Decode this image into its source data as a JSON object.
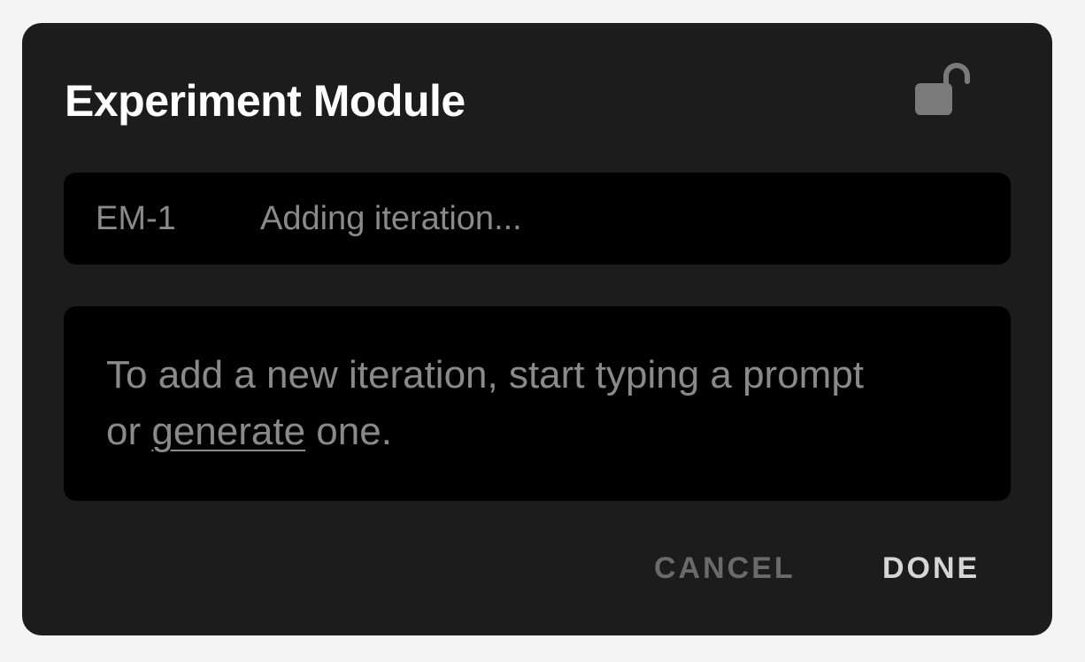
{
  "dialog": {
    "title": "Experiment Module",
    "lock_icon": "unlocked-padlock-icon"
  },
  "iteration": {
    "id": "EM-1",
    "status": "Adding iteration..."
  },
  "prompt": {
    "text_before": "To add a new iteration, start typing a prompt or ",
    "link_label": "generate",
    "text_after": " one."
  },
  "actions": {
    "cancel_label": "CANCEL",
    "done_label": "DONE"
  },
  "colors": {
    "dialog_background": "#1c1c1c",
    "field_background": "#000000",
    "page_background": "#f4f4f4",
    "muted_text": "#8a8a8a",
    "title_text": "#ffffff",
    "lock_icon": "#7a7a7a"
  }
}
